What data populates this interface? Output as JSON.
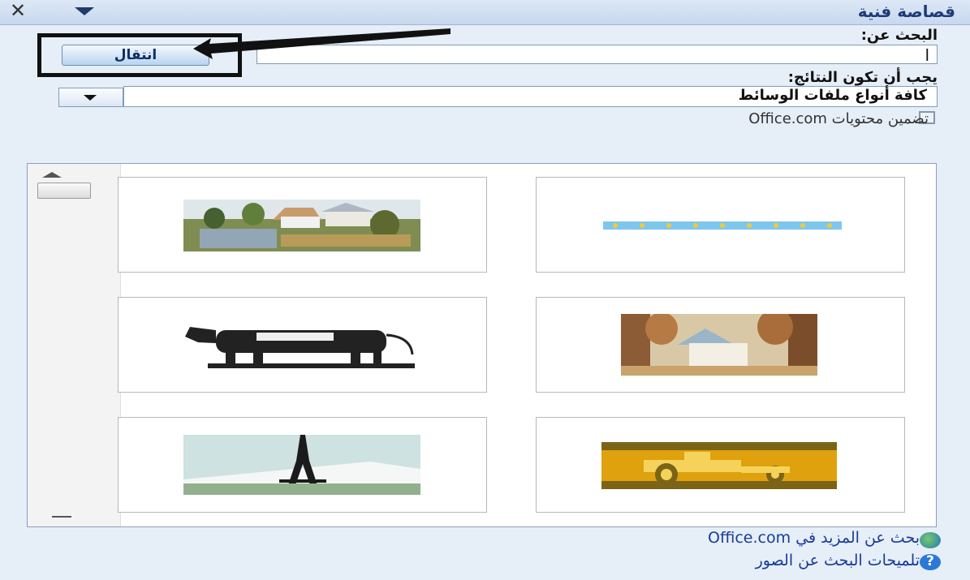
{
  "window": {
    "title": "قصاصة فنية"
  },
  "search": {
    "label": "البحث عن:",
    "value": "ا",
    "go_label": "انتقال"
  },
  "results_filter": {
    "label": "يجب أن تكون النتائج:",
    "selected": "كافة أنواع ملفات الوسائط"
  },
  "include_office": {
    "label": "تضمين محتويات Office.com",
    "checked": false
  },
  "clips": [
    {
      "name": "village-landscape"
    },
    {
      "name": "dotted-border-strip"
    },
    {
      "name": "cow"
    },
    {
      "name": "house-in-trees"
    },
    {
      "name": "eiffel-tower"
    },
    {
      "name": "tractor"
    }
  ],
  "footer": {
    "more_link": "بحث عن المزيد في Office.com",
    "tips_link": "تلميحات البحث عن الصور"
  },
  "icons": {
    "close": "close-icon",
    "menu": "chevron-down-icon",
    "globe": "globe-icon",
    "help": "help-icon"
  },
  "colors": {
    "accent": "#173b98",
    "panel": "#e6eef8"
  }
}
